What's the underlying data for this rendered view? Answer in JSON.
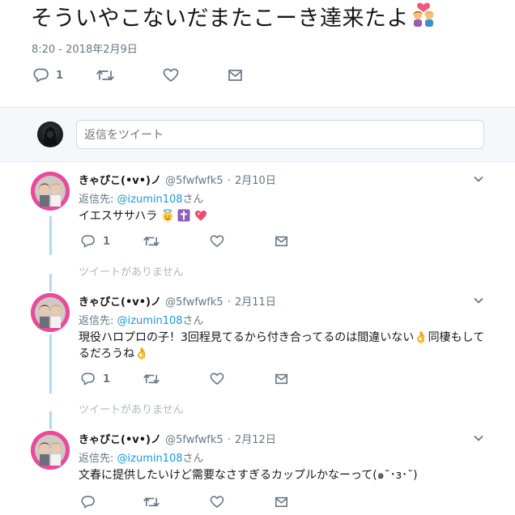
{
  "main_tweet": {
    "text": "そういやこないだまたこーき達来たよ",
    "timestamp": "8:20 - 2018年2月9日",
    "reply_count": "1"
  },
  "reply_box": {
    "placeholder": "返信をツイート"
  },
  "replies": [
    {
      "name": "きゃぴこ(•v•)ノ",
      "handle": "@5fwfwfk5",
      "sep": "·",
      "date": "2月10日",
      "reply_to_prefix": "返信先: ",
      "reply_to_mention": "@izumin108",
      "reply_to_suffix": "さん",
      "text_line1": "イエスササハラ",
      "text_line2": "",
      "reply_count": "1",
      "unavailable": "ツイートがありません"
    },
    {
      "name": "きゃぴこ(•v•)ノ",
      "handle": "@5fwfwfk5",
      "sep": "·",
      "date": "2月11日",
      "reply_to_prefix": "返信先: ",
      "reply_to_mention": "@izumin108",
      "reply_to_suffix": "さん",
      "text_line1": "現役ハロプロの子！3回程見てるから付き合ってるのは間違いない👌同棲もして",
      "text_line2": "るだろうね👌",
      "reply_count": "1",
      "unavailable": "ツイートがありません"
    },
    {
      "name": "きゃぴこ(•v•)ノ",
      "handle": "@5fwfwfk5",
      "sep": "·",
      "date": "2月12日",
      "reply_to_prefix": "返信先: ",
      "reply_to_mention": "@izumin108",
      "reply_to_suffix": "さん",
      "text_line1": "文春に提供したいけど需要なさすぎるカップルかなーって(๑˘･з･˘)",
      "text_line2": "",
      "reply_count": "",
      "unavailable": ""
    }
  ],
  "icons": {
    "reply": "reply-icon",
    "retweet": "retweet-icon",
    "like": "heart-icon",
    "dm": "envelope-icon",
    "more": "chevron-down-icon"
  },
  "colors": {
    "accent": "#1b95e0",
    "muted": "#657786",
    "thread": "#b5d9f3"
  }
}
